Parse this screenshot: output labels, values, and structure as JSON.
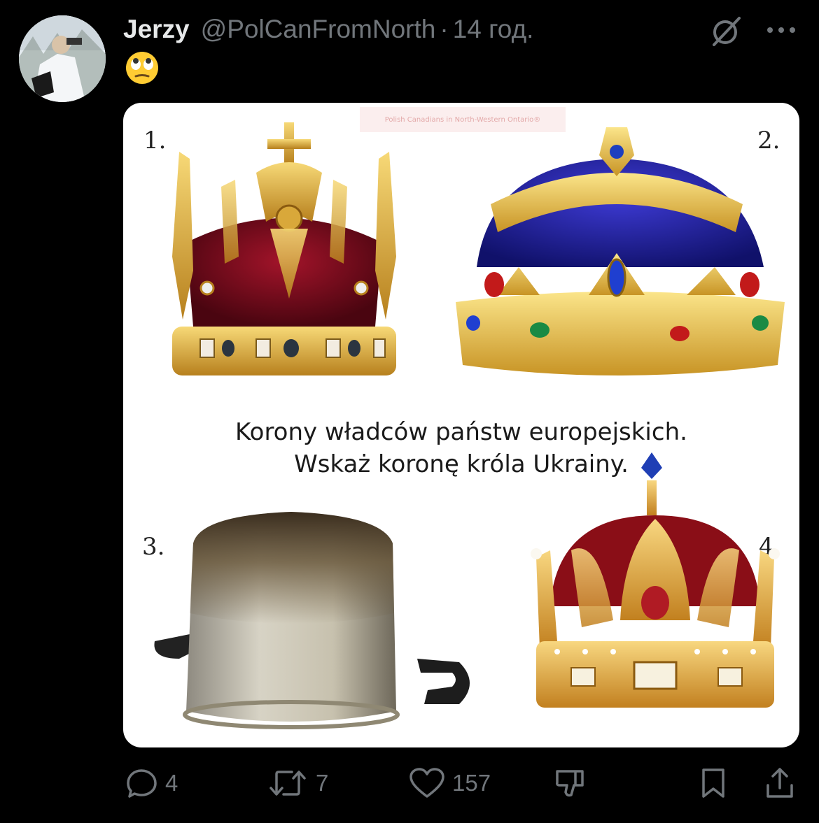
{
  "post": {
    "author_name": "Jerzy",
    "handle": "@PolCanFromNorth",
    "separator": "·",
    "time": "14 год.",
    "body_emoji": "🙄"
  },
  "media": {
    "watermark": "Polish Canadians in North-Western Ontario®",
    "labels": [
      "1.",
      "2.",
      "3.",
      "4."
    ],
    "caption_line1": "Korony władców państw europejskich.",
    "caption_line2": "Wskaż koronę króla Ukrainy."
  },
  "actions": {
    "replies": "4",
    "reposts": "7",
    "likes": "157"
  },
  "colors": {
    "background": "#000000",
    "secondary_text": "#71767b",
    "primary_text": "#e7e9ea"
  },
  "icons": [
    "grok-icon",
    "more-icon",
    "reply-icon",
    "repost-icon",
    "like-icon",
    "dislike-icon",
    "bookmark-icon",
    "share-icon"
  ]
}
